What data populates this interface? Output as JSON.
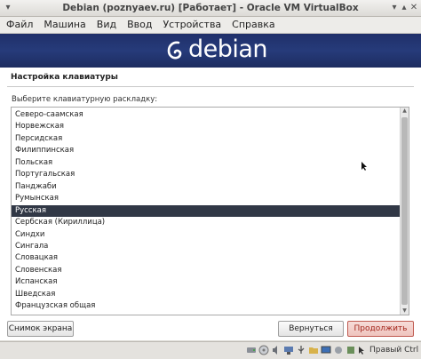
{
  "window": {
    "title": "Debian (poznyaev.ru) [Работает] - Oracle VM VirtualBox"
  },
  "menu": [
    "Файл",
    "Машина",
    "Вид",
    "Ввод",
    "Устройства",
    "Справка"
  ],
  "banner": {
    "logo_text": "debian"
  },
  "installer": {
    "title": "Настройка клавиатуры",
    "prompt": "Выберите клавиатурную раскладку:",
    "options": [
      "Северо-саамская",
      "Норвежская",
      "Персидская",
      "Филиппинская",
      "Польская",
      "Португальская",
      "Панджаби",
      "Румынская",
      "Русская",
      "Сербская (Кириллица)",
      "Синдхи",
      "Сингала",
      "Словацкая",
      "Словенская",
      "Испанская",
      "Шведская",
      "Французская общая"
    ],
    "selected_option": "Русская",
    "screenshot_button": "Снимок экрана",
    "back_button": "Вернуться",
    "continue_button": "Продолжить"
  },
  "statusbar": {
    "host_key": "Правый Ctrl"
  },
  "colors": {
    "banner": "#263b7a",
    "selection": "#313846",
    "continue_text": "#a4261c"
  }
}
